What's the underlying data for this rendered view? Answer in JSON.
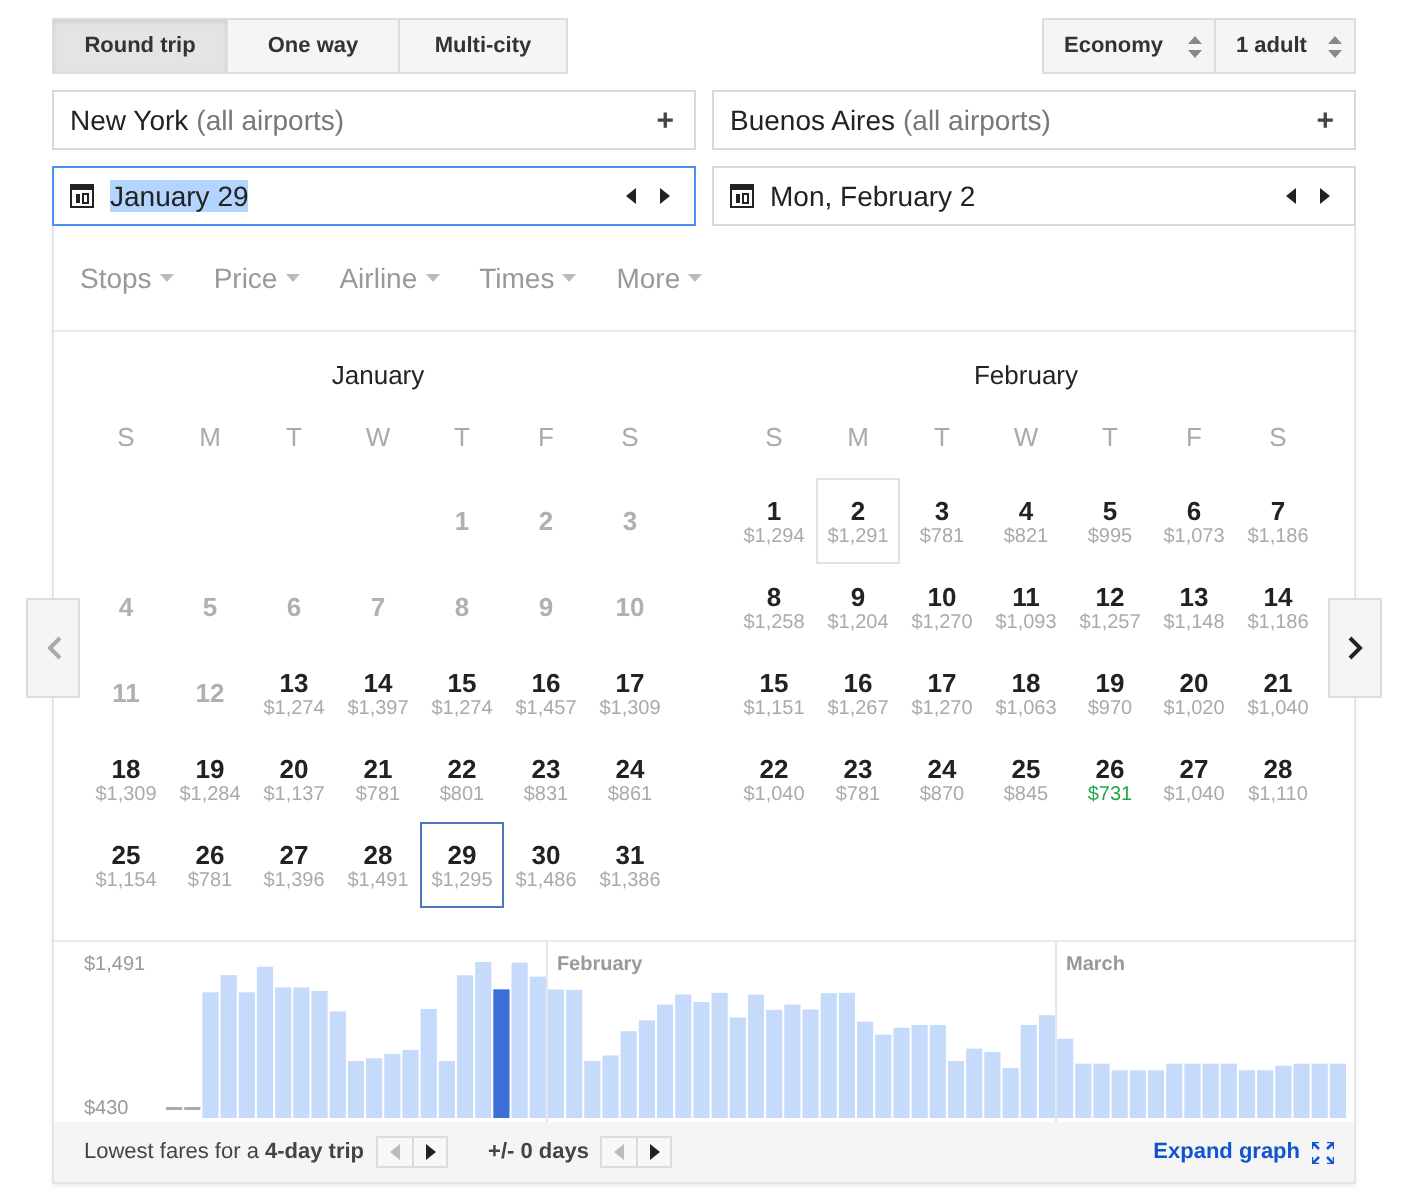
{
  "trip_types": [
    {
      "label": "Round trip",
      "selected": true
    },
    {
      "label": "One way",
      "selected": false
    },
    {
      "label": "Multi-city",
      "selected": false
    }
  ],
  "cabin_select": {
    "value": "Economy"
  },
  "passengers_select": {
    "value": "1 adult"
  },
  "origin": {
    "value": "New York",
    "hint": "(all airports)",
    "action": "+"
  },
  "destination": {
    "value": "Buenos Aires",
    "hint": "(all airports)",
    "action": "+"
  },
  "departure_date": {
    "value": "January 29",
    "focused": true
  },
  "return_date": {
    "value": "Mon, February 2",
    "focused": false
  },
  "filters": [
    "Stops",
    "Price",
    "Airline",
    "Times",
    "More"
  ],
  "months": [
    {
      "title": "January",
      "weekdays": [
        "S",
        "M",
        "T",
        "W",
        "T",
        "F",
        "S"
      ],
      "days": [
        {
          "kind": "blank"
        },
        {
          "kind": "blank"
        },
        {
          "kind": "blank"
        },
        {
          "kind": "blank"
        },
        {
          "kind": "unavailable",
          "day": "1",
          "selected": false
        },
        {
          "kind": "unavailable",
          "day": "2",
          "selected": false
        },
        {
          "kind": "unavailable",
          "day": "3",
          "selected": false
        },
        {
          "kind": "unavailable",
          "day": "4",
          "selected": false
        },
        {
          "kind": "unavailable",
          "day": "5",
          "selected": false
        },
        {
          "kind": "unavailable",
          "day": "6",
          "selected": false
        },
        {
          "kind": "unavailable",
          "day": "7",
          "selected": false
        },
        {
          "kind": "unavailable",
          "day": "8",
          "selected": false
        },
        {
          "kind": "unavailable",
          "day": "9",
          "selected": false
        },
        {
          "kind": "unavailable",
          "day": "10",
          "selected": false
        },
        {
          "kind": "unavailable",
          "day": "11",
          "selected": false
        },
        {
          "kind": "unavailable",
          "day": "12",
          "selected": false
        },
        {
          "kind": "fare",
          "day": "13",
          "price": "$1,274",
          "selected": false
        },
        {
          "kind": "fare",
          "day": "14",
          "price": "$1,397",
          "selected": false
        },
        {
          "kind": "fare",
          "day": "15",
          "price": "$1,274",
          "selected": false
        },
        {
          "kind": "fare",
          "day": "16",
          "price": "$1,457",
          "selected": false
        },
        {
          "kind": "fare",
          "day": "17",
          "price": "$1,309",
          "selected": false
        },
        {
          "kind": "fare",
          "day": "18",
          "price": "$1,309",
          "selected": false
        },
        {
          "kind": "fare",
          "day": "19",
          "price": "$1,284",
          "selected": false
        },
        {
          "kind": "fare",
          "day": "20",
          "price": "$1,137",
          "selected": false
        },
        {
          "kind": "fare",
          "day": "21",
          "price": "$781",
          "selected": false
        },
        {
          "kind": "fare",
          "day": "22",
          "price": "$801",
          "selected": false
        },
        {
          "kind": "fare",
          "day": "23",
          "price": "$831",
          "selected": false
        },
        {
          "kind": "fare",
          "day": "24",
          "price": "$861",
          "selected": false
        },
        {
          "kind": "fare",
          "day": "25",
          "price": "$1,154",
          "selected": false
        },
        {
          "kind": "fare",
          "day": "26",
          "price": "$781",
          "selected": false
        },
        {
          "kind": "fare",
          "day": "27",
          "price": "$1,396",
          "selected": false
        },
        {
          "kind": "fare",
          "day": "28",
          "price": "$1,491",
          "selected": false
        },
        {
          "kind": "fare",
          "day": "29",
          "price": "$1,295",
          "selected": true
        },
        {
          "kind": "fare",
          "day": "30",
          "price": "$1,486",
          "selected": false
        },
        {
          "kind": "fare",
          "day": "31",
          "price": "$1,386",
          "selected": false
        }
      ]
    },
    {
      "title": "February",
      "weekdays": [
        "S",
        "M",
        "T",
        "W",
        "T",
        "F",
        "S"
      ],
      "days": [
        {
          "kind": "fare",
          "day": "1",
          "price": "$1,294",
          "selected": false
        },
        {
          "kind": "return",
          "day": "2",
          "price": "$1,291",
          "selected": false
        },
        {
          "kind": "fare",
          "day": "3",
          "price": "$781",
          "selected": false
        },
        {
          "kind": "fare",
          "day": "4",
          "price": "$821",
          "selected": false
        },
        {
          "kind": "fare",
          "day": "5",
          "price": "$995",
          "selected": false
        },
        {
          "kind": "fare",
          "day": "6",
          "price": "$1,073",
          "selected": false
        },
        {
          "kind": "fare",
          "day": "7",
          "price": "$1,186",
          "selected": false
        },
        {
          "kind": "fare",
          "day": "8",
          "price": "$1,258",
          "selected": false
        },
        {
          "kind": "fare",
          "day": "9",
          "price": "$1,204",
          "selected": false
        },
        {
          "kind": "fare",
          "day": "10",
          "price": "$1,270",
          "selected": false
        },
        {
          "kind": "fare",
          "day": "11",
          "price": "$1,093",
          "selected": false
        },
        {
          "kind": "fare",
          "day": "12",
          "price": "$1,257",
          "selected": false
        },
        {
          "kind": "fare",
          "day": "13",
          "price": "$1,148",
          "selected": false
        },
        {
          "kind": "fare",
          "day": "14",
          "price": "$1,186",
          "selected": false
        },
        {
          "kind": "fare",
          "day": "15",
          "price": "$1,151",
          "selected": false
        },
        {
          "kind": "fare",
          "day": "16",
          "price": "$1,267",
          "selected": false
        },
        {
          "kind": "fare",
          "day": "17",
          "price": "$1,270",
          "selected": false
        },
        {
          "kind": "fare",
          "day": "18",
          "price": "$1,063",
          "selected": false
        },
        {
          "kind": "fare",
          "day": "19",
          "price": "$970",
          "selected": false
        },
        {
          "kind": "fare",
          "day": "20",
          "price": "$1,020",
          "selected": false
        },
        {
          "kind": "fare",
          "day": "21",
          "price": "$1,040",
          "selected": false
        },
        {
          "kind": "fare",
          "day": "22",
          "price": "$1,040",
          "selected": false
        },
        {
          "kind": "fare",
          "day": "23",
          "price": "$781",
          "selected": false
        },
        {
          "kind": "fare",
          "day": "24",
          "price": "$870",
          "selected": false
        },
        {
          "kind": "fare",
          "day": "25",
          "price": "$845",
          "selected": false
        },
        {
          "kind": "lowest",
          "day": "26",
          "price": "$731",
          "selected": false
        },
        {
          "kind": "fare",
          "day": "27",
          "price": "$1,040",
          "selected": false
        },
        {
          "kind": "fare",
          "day": "28",
          "price": "$1,110",
          "selected": false
        }
      ]
    }
  ],
  "fare_graph": {
    "top_price": "$1,491",
    "bottom_price": "$430",
    "month_labels": [
      "February",
      "March"
    ]
  },
  "footer": {
    "trip_length": "Lowest fares for a **4-day trip**",
    "flex_days": "+/- 0 days",
    "flex_back_disabled": true,
    "expand_link": "Expand graph"
  }
}
